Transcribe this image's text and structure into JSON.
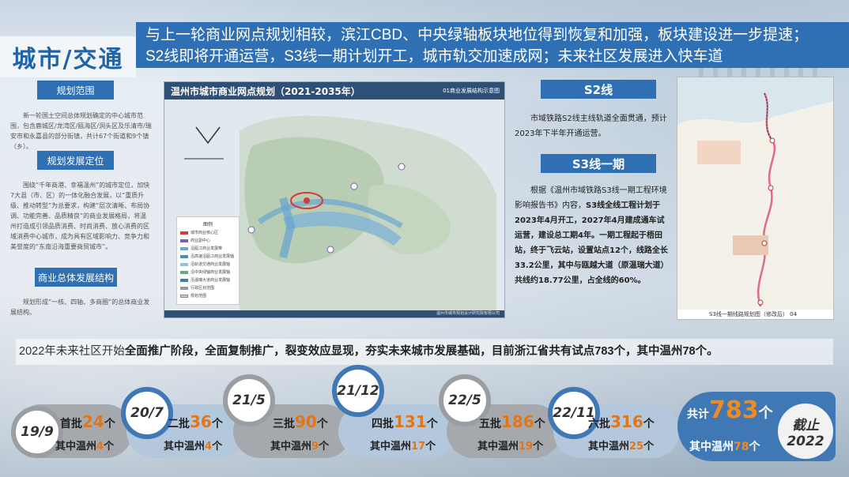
{
  "section_title": "城市/交通",
  "headline": {
    "line1": "与上一轮商业网点规划相较，滨江CBD、中央绿轴板块地位得到恢复和加强，板块建设进一步提速；",
    "line2": "S2线即将开通运营，S3线一期计划开工，城市轨交加速成网；未来社区发展进入快车道"
  },
  "left": {
    "planning_scope": {
      "label": "规划范围",
      "text": "新一轮国土空间总体规划确定的中心城市范围，包含鹿城区/龙湾区/瓯海区/洞头区及乐清市/瑞安市和永嘉县的部分街镇，共计67个街道和9个镇（乡）。"
    },
    "planning_position": {
      "label": "规划发展定位",
      "text": "围绕“千年商港、幸福温州”的城市定位，加快7大县（市、区）的一体化融合发展，以“重质升级、推动转型”为总要求，构建“层次清晰、布局协调、功能完善、品质精良”的商业发展格局，将温州打造成引领品质消费、时尚消费、放心消费的区域消费中心城市，成为具有区域影响力、竞争力和美誉度的“东南沿海重要商贸城市”。"
    },
    "overall_structure": {
      "label": "商业总体发展结构",
      "text": "规划形成“一核、四轴、多商圈”的总体商业发展结构。"
    }
  },
  "map": {
    "title": "温州市城市商业网点规划（2021-2035年）",
    "subtitle": "01商业发展结构示意图",
    "footer": "温州市城市规划设计研究院有限公司",
    "legend_title": "图例",
    "legend_items": [
      "城市商业核心区",
      "商业副中心",
      "沿瓯江商业发展带",
      "沿高速沿瓯江商业发展轴",
      "沿轨道交通商业发展轴",
      "沿中央绿轴商业发展轴",
      "沿温瑞大道商业发展轴",
      "行政区划范围",
      "规划范围"
    ]
  },
  "s2": {
    "label": "S2线",
    "text": "市域铁路S2线主线轨道全面贯通，预计2023年下半年开通运营。"
  },
  "s3": {
    "label": "S3线一期",
    "text_plain": "根据《温州市域铁路S3线一期工程环境影响报告书》内容，",
    "text_bold": "S3线全线工程计划于2023年4月开工，2027年4月建成通车试运营，建设总工期4年。一期工程起于梧田站，终于飞云站，设置站点12个，线路全长33.2公里，其中与瓯越大道（原温瑞大道）共线约18.77公里，占全线的60%。"
  },
  "route_map": {
    "caption": "S3线一期线路规划图（修改后）  04"
  },
  "banner": {
    "prefix": "2022年未来社区开始",
    "bold1": "全面推广阶段，全面复制推广，裂变效应显现，夯实未来城市发展基础，目前浙江省共有试点783个，其中温州78个。"
  },
  "timeline": [
    {
      "date": "19/9",
      "batch": "首批",
      "count": "24",
      "unit": "个",
      "sub_prefix": "其中温州",
      "sub_count": "4",
      "sub_unit": "个",
      "color": "grey"
    },
    {
      "date": "20/7",
      "batch": "二批",
      "count": "36",
      "unit": "个",
      "sub_prefix": "其中温州",
      "sub_count": "4",
      "sub_unit": "个",
      "color": "blue"
    },
    {
      "date": "21/5",
      "batch": "三批",
      "count": "90",
      "unit": "个",
      "sub_prefix": "其中温州",
      "sub_count": "9",
      "sub_unit": "个",
      "color": "grey"
    },
    {
      "date": "21/12",
      "batch": "四批",
      "count": "131",
      "unit": "个",
      "sub_prefix": "其中温州",
      "sub_count": "17",
      "sub_unit": "个",
      "color": "blue"
    },
    {
      "date": "22/5",
      "batch": "五批",
      "count": "186",
      "unit": "个",
      "sub_prefix": "其中温州",
      "sub_count": "19",
      "sub_unit": "个",
      "color": "grey"
    },
    {
      "date": "22/11",
      "batch": "六批",
      "count": "316",
      "unit": "个",
      "sub_prefix": "其中温州",
      "sub_count": "25",
      "sub_unit": "个",
      "color": "blue"
    }
  ],
  "total": {
    "prefix": "共计",
    "count": "783",
    "unit": "个",
    "sub_prefix": "其中温州",
    "sub_count": "78",
    "sub_unit": "个"
  },
  "end_label": {
    "line1": "截止",
    "line2": "2022"
  },
  "colors": {
    "primary_blue": "#2f6fb3",
    "accent_orange": "#e0761a",
    "timeline_grey": "#a5a9ae",
    "timeline_blue": "#b4c8dd"
  }
}
